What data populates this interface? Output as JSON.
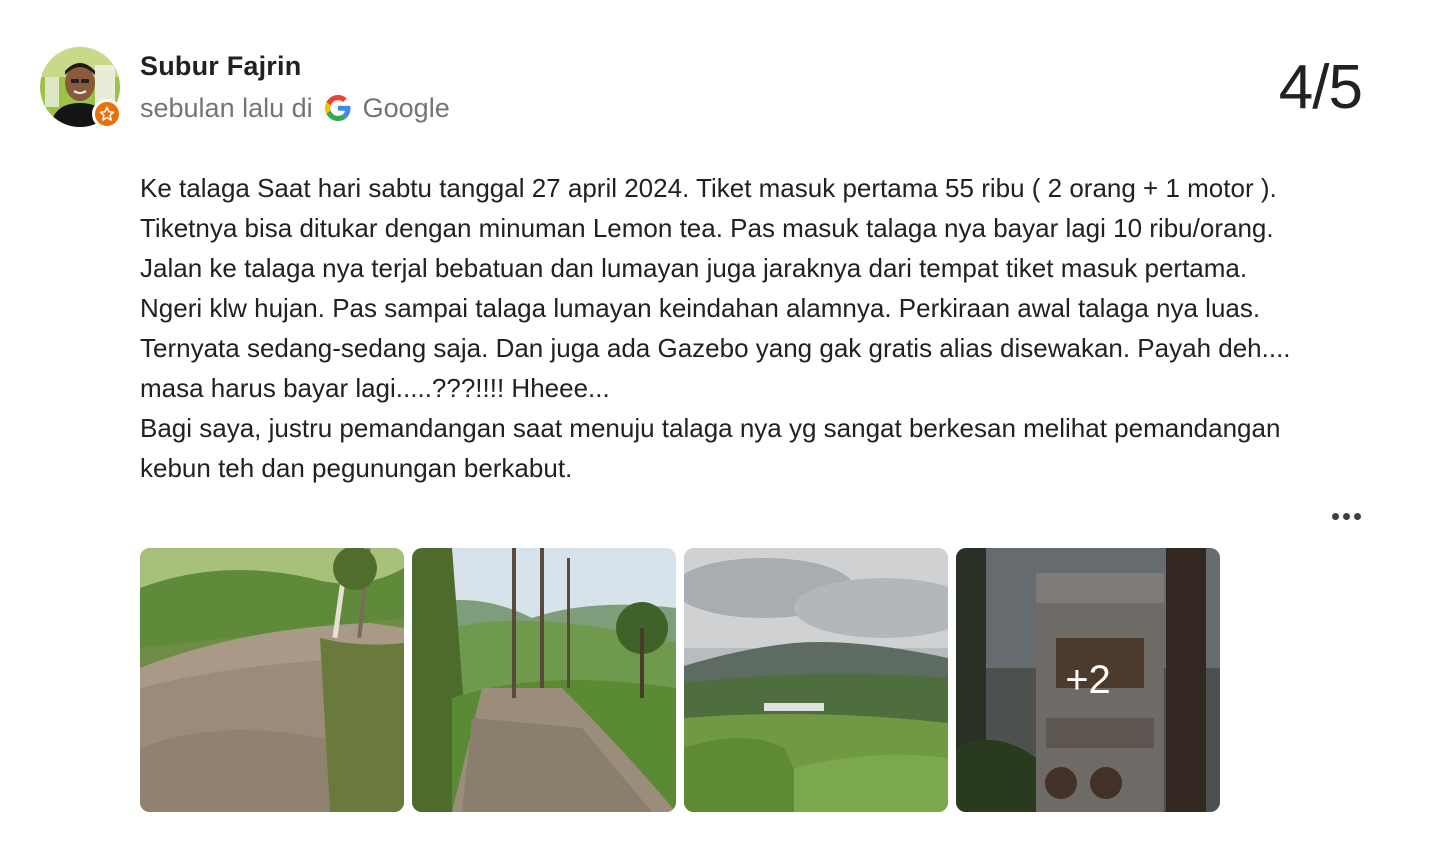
{
  "review": {
    "author_name": "Subur Fajrin",
    "time_ago": "sebulan lalu di",
    "source": "Google",
    "rating": "4/5",
    "paragraphs": [
      "Ke talaga Saat hari sabtu tanggal 27 april 2024. Tiket masuk pertama 55 ribu ( 2 orang + 1 motor ). Tiketnya bisa ditukar dengan minuman Lemon tea. Pas masuk talaga nya bayar lagi 10 ribu/orang. Jalan ke talaga nya terjal bebatuan dan lumayan juga jaraknya dari tempat tiket masuk pertama. Ngeri klw hujan. Pas sampai talaga lumayan keindahan alamnya. Perkiraan awal talaga nya luas. Ternyata sedang-sedang saja. Dan juga ada Gazebo yang gak gratis alias disewakan. Payah deh.... masa harus bayar lagi.....???!!!! Hheee...",
      "Bagi saya, justru pemandangan saat menuju talaga nya yg sangat berkesan melihat pemandangan kebun teh dan pegunungan berkabut."
    ],
    "more_photos_label": "+2"
  },
  "icons": {
    "avatar_badge": "local-guide-star-icon",
    "source_logo": "google-g-icon",
    "more": "more-horizontal-icon"
  },
  "colors": {
    "badge": "#e8710a",
    "meta_text": "#70757a",
    "text": "#202124"
  }
}
